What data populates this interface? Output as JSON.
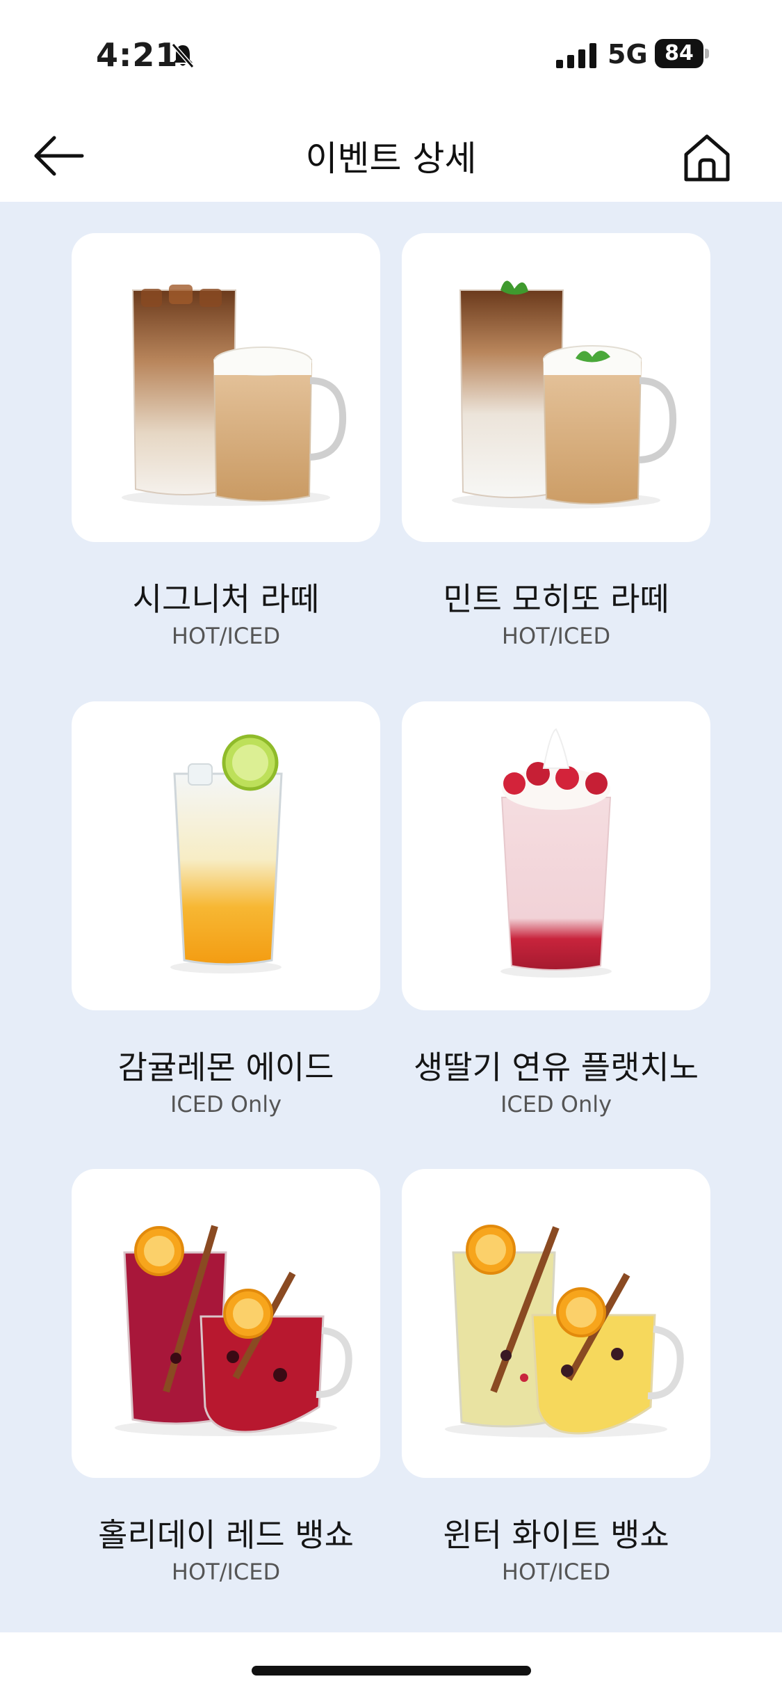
{
  "status_bar": {
    "time": "4:21",
    "network": "5G",
    "battery": "84",
    "icons": [
      "bell-off-icon",
      "signal-icon",
      "battery-icon"
    ]
  },
  "header": {
    "title": "이벤트 상세",
    "back_icon": "arrow-left-icon",
    "home_icon": "home-icon"
  },
  "colors": {
    "content_background": "#e6edf8",
    "card_background": "#ffffff"
  },
  "products": [
    {
      "name": "시그니처 라떼",
      "option": "HOT/ICED"
    },
    {
      "name": "민트 모히또 라떼",
      "option": "HOT/ICED"
    },
    {
      "name": "감귤레몬 에이드",
      "option": "ICED Only"
    },
    {
      "name": "생딸기 연유 플랫치노",
      "option": "ICED Only"
    },
    {
      "name": "홀리데이 레드 뱅쇼",
      "option": "HOT/ICED"
    },
    {
      "name": "윈터 화이트 뱅쇼",
      "option": "HOT/ICED"
    }
  ]
}
